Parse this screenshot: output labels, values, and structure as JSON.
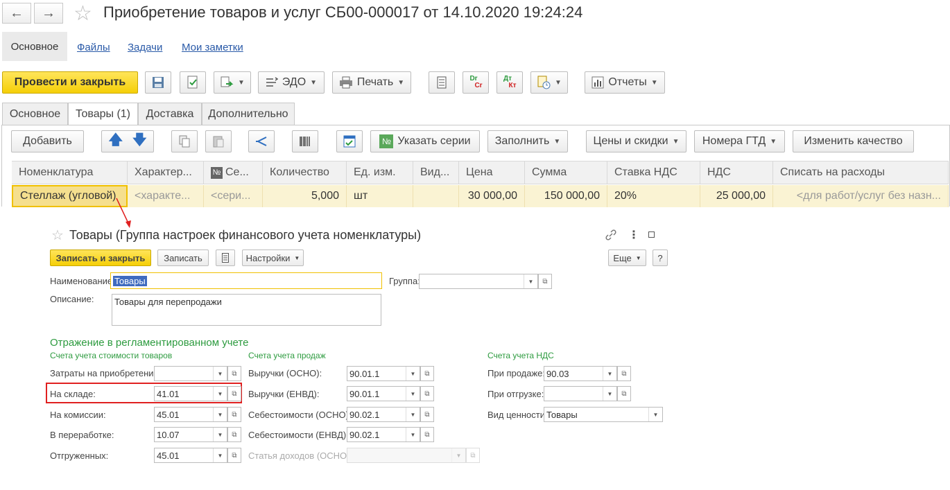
{
  "window": {
    "title": "Приобретение товаров и услуг СБ00-000017 от 14.10.2020 19:24:24"
  },
  "top_nav": [
    "Основное",
    "Файлы",
    "Задачи",
    "Мои заметки"
  ],
  "toolbar": {
    "post_close": "Провести и закрыть",
    "edo": "ЭДО",
    "print": "Печать",
    "reports": "Отчеты",
    "dt_kt_1": "Dr",
    "dt_kt_2": "Cr",
    "dt_kt_3": "Дт",
    "dt_kt_4": "Кт"
  },
  "tabs": [
    "Основное",
    "Товары (1)",
    "Доставка",
    "Дополнительно"
  ],
  "goods_toolbar": {
    "add": "Добавить",
    "series": "Указать серии",
    "fill": "Заполнить",
    "prices": "Цены и скидки",
    "gtd": "Номера ГТД",
    "quality": "Изменить качество"
  },
  "table": {
    "columns": [
      "Номенклатура",
      "Характер...",
      "Се...",
      "Количество",
      "Ед. изм.",
      "Вид...",
      "Цена",
      "Сумма",
      "Ставка НДС",
      "НДС",
      "Списать на расходы"
    ],
    "series_icon_label": "№",
    "row": {
      "item": "Стеллаж (угловой)",
      "characteristic": "<характе...",
      "series": "<сери...",
      "quantity": "5,000",
      "unit": "шт",
      "type": "",
      "price": "30 000,00",
      "sum": "150 000,00",
      "vat_rate": "20%",
      "vat": "25 000,00",
      "expense": "<для работ/услуг без назн..."
    }
  },
  "popup": {
    "title": "Товары (Группа настроек финансового учета номенклатуры)",
    "save_close": "Записать и закрыть",
    "save": "Записать",
    "settings": "Настройки",
    "more": "Еще",
    "help": "?",
    "name_label": "Наименование:",
    "name_value": "Товары",
    "group_label": "Группа:",
    "group_value": "",
    "description_label": "Описание:",
    "description_value": "Товары для перепродажи",
    "section_title": "Отражение в регламентированном учете",
    "col1_title": "Счета учета стоимости товаров",
    "col2_title": "Счета учета продаж",
    "col3_title": "Счета учета НДС",
    "col1": [
      {
        "label": "Затраты на приобретение:",
        "value": ""
      },
      {
        "label": "На складе:",
        "value": "41.01"
      },
      {
        "label": "На комиссии:",
        "value": "45.01"
      },
      {
        "label": "В переработке:",
        "value": "10.07"
      },
      {
        "label": "Отгруженных:",
        "value": "45.01"
      }
    ],
    "col2": [
      {
        "label": "Выручки (ОСНО):",
        "value": "90.01.1"
      },
      {
        "label": "Выручки (ЕНВД):",
        "value": "90.01.1"
      },
      {
        "label": "Себестоимости (ОСНО):",
        "value": "90.02.1"
      },
      {
        "label": "Себестоимости (ЕНВД):",
        "value": "90.02.1"
      },
      {
        "label": "Статья доходов (ОСНО):",
        "value": ""
      }
    ],
    "col3": [
      {
        "label": "При продаже:",
        "value": "90.03"
      },
      {
        "label": "При отгрузке:",
        "value": ""
      },
      {
        "label": "Вид ценности:",
        "value": "Товары"
      }
    ]
  },
  "colors": {
    "accent_yellow": "#f5cf07",
    "link_blue": "#2a5aa8",
    "section_green": "#2d9b3f",
    "highlight_red": "#e02020",
    "row_highlight": "#faf3d3"
  }
}
